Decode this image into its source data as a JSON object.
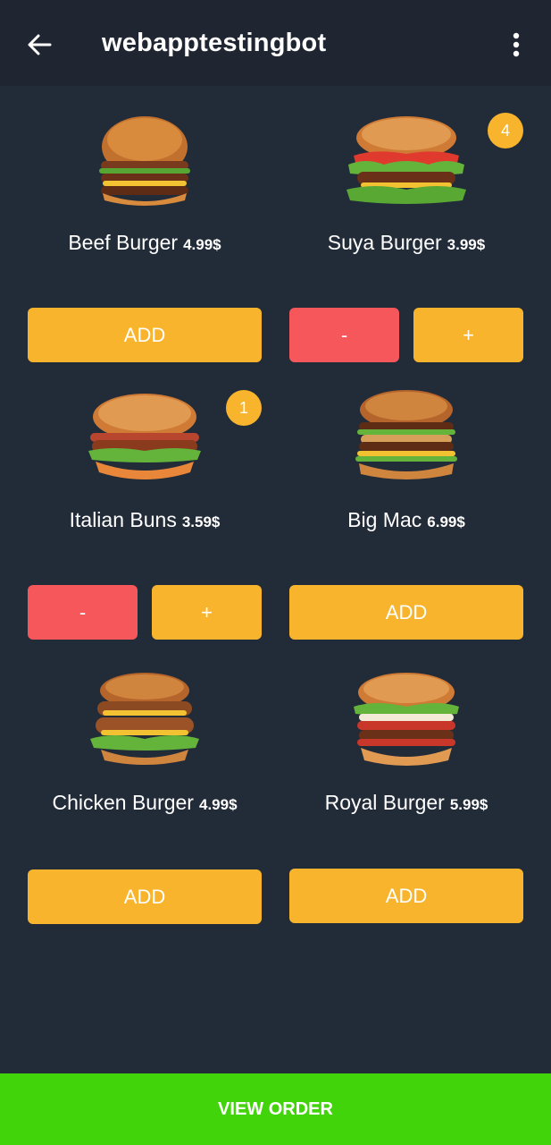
{
  "app": {
    "title": "webapptestingbot"
  },
  "header": {
    "back_icon": "arrow-left-icon",
    "menu_icon": "more-vert-icon"
  },
  "items": [
    {
      "name": "Beef Burger",
      "price": "4.99$",
      "count": null,
      "add_label": "ADD"
    },
    {
      "name": "Suya Burger",
      "price": "3.99$",
      "count": "4",
      "minus_label": "-",
      "plus_label": "+"
    },
    {
      "name": "Italian Buns",
      "price": "3.59$",
      "count": "1",
      "minus_label": "-",
      "plus_label": "+"
    },
    {
      "name": "Big Mac",
      "price": "6.99$",
      "count": null,
      "add_label": "ADD"
    },
    {
      "name": "Chicken Burger",
      "price": "4.99$",
      "count": null,
      "add_label": "ADD"
    },
    {
      "name": "Royal Burger",
      "price": "5.99$",
      "count": null,
      "add_label": "ADD"
    }
  ],
  "footer": {
    "view_order_label": "VIEW ORDER"
  },
  "colors": {
    "background": "#222b38",
    "header": "#1f2631",
    "accent": "#f7b42c",
    "minus": "#f5575a",
    "view_order": "#41d40b"
  }
}
